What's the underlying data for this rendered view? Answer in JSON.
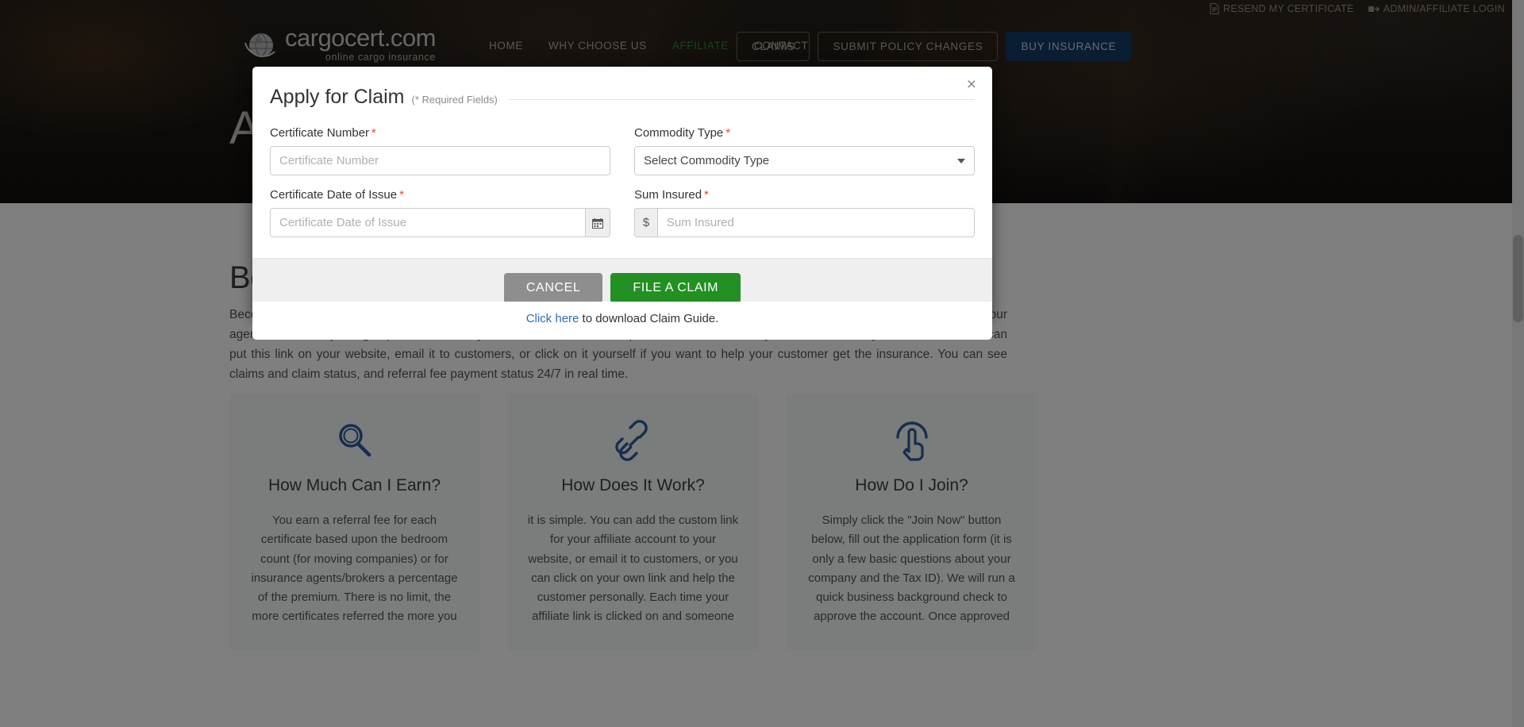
{
  "topbar": {
    "links": [
      {
        "label": "RESEND MY CERTIFICATE",
        "icon": "document-icon"
      },
      {
        "label": "ADMIN/AFFILIATE LOGIN",
        "icon": "login-icon"
      }
    ]
  },
  "brand": {
    "name": "cargocert.com",
    "tagline": "online cargo insurance",
    "logo_icon": "globe-icon"
  },
  "nav": {
    "links": [
      {
        "label": "HOME",
        "active": false
      },
      {
        "label": "WHY CHOOSE US",
        "active": false
      },
      {
        "label": "AFFILIATE",
        "active": true
      },
      {
        "label": "CONTACT",
        "active": false
      }
    ],
    "buttons": [
      {
        "label": "CLAIMS",
        "style": "outline"
      },
      {
        "label": "SUBMIT POLICY CHANGES",
        "style": "outline"
      },
      {
        "label": "BUY INSURANCE",
        "style": "primary"
      }
    ],
    "active_color": "#2e8b2e",
    "primary_color": "#123a66"
  },
  "hero": {
    "title": "A"
  },
  "page": {
    "section_title": "Be",
    "paragraph": "Become an affiliate and earn a referral fee for each certificate sold. You can refer customers for referral fees or sell insurance yourself with our agent tools. Once you sign up as an affiliate, you will receive an account portal and a tracked link you can share with your customers. You can put this link on your website, email it to customers, or click on it yourself if you want to help your customer get the insurance. You can see claims and claim status, and referral fee payment status 24/7 in real time.",
    "cards": [
      {
        "icon": "magnifier-icon",
        "title": "How Much Can I Earn?",
        "text": "You earn a referral fee for each certificate based upon the bedroom count (for moving companies) or for insurance agents/brokers a percentage of the premium. There is no limit, the more certificates referred the more you"
      },
      {
        "icon": "chain-link-icon",
        "title": "How Does It Work?",
        "text": "it is simple. You can add the custom link for your affiliate account to your website, or email it to customers, or you can click on your own link and help the customer personally. Each time your affiliate link is clicked on and someone"
      },
      {
        "icon": "hand-pointer-icon",
        "title": "How Do I Join?",
        "text": "Simply click the \"Join Now\" button below, fill out the application form (it is only a few basic questions about your company and the Tax ID). We will run a quick business background check to approve the account. Once approved"
      }
    ]
  },
  "modal": {
    "title": "Apply for Claim",
    "required_note": "(* Required Fields)",
    "close_label": "×",
    "fields": {
      "certificate_number": {
        "label": "Certificate Number",
        "required": true,
        "value": "",
        "placeholder": "Certificate Number"
      },
      "commodity_type": {
        "label": "Commodity Type",
        "required": true,
        "selected": "Select Commodity Type",
        "options": [
          "Select Commodity Type"
        ]
      },
      "certificate_date_of_issue": {
        "label": "Certificate Date of Issue",
        "required": true,
        "value": "",
        "placeholder": "Certificate Date of Issue",
        "addon_icon": "calendar-icon"
      },
      "sum_insured": {
        "label": "Sum Insured",
        "required": true,
        "value": "",
        "placeholder": "Sum Insured",
        "addon_prefix": "$"
      }
    },
    "buttons": {
      "cancel": "CANCEL",
      "submit": "FILE A CLAIM"
    },
    "guide": {
      "link_text": "Click here",
      "rest_text": " to download Claim Guide."
    },
    "required_marker": "*",
    "required_color": "#e8453c",
    "submit_color": "#229022",
    "cancel_color": "#8e8e8e",
    "link_color": "#2a6fb5"
  }
}
